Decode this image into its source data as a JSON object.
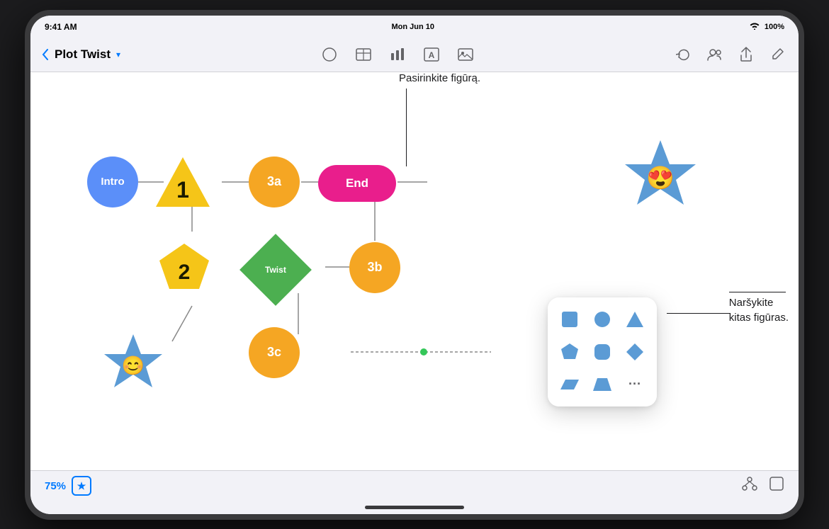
{
  "app": {
    "title": "Plot Twist",
    "status_time": "9:41 AM",
    "status_day": "Mon Jun 10",
    "battery": "100%",
    "zoom_level": "75%"
  },
  "annotations": {
    "top": "Pasirinkite figūrą.",
    "right_line1": "Naršykite",
    "right_line2": "kitas figūras."
  },
  "toolbar": {
    "back_label": "Plot Twist",
    "center_icons": [
      "circle-icon",
      "rectangle-icon",
      "layers-icon",
      "text-icon",
      "image-icon"
    ],
    "right_icons": [
      "rotate-icon",
      "person-icon",
      "share-icon",
      "pencil-icon"
    ]
  },
  "flowchart": {
    "nodes": [
      {
        "id": "intro",
        "label": "Intro",
        "shape": "circle",
        "color": "#5b8ff9"
      },
      {
        "id": "n1",
        "label": "1",
        "shape": "triangle",
        "color": "#f5c518"
      },
      {
        "id": "n3a",
        "label": "3a",
        "shape": "circle",
        "color": "#f5a623"
      },
      {
        "id": "end",
        "label": "End",
        "shape": "rounded-rect",
        "color": "#e91e8c"
      },
      {
        "id": "n2",
        "label": "2",
        "shape": "pentagon",
        "color": "#f5c518"
      },
      {
        "id": "twist",
        "label": "Twist",
        "shape": "diamond",
        "color": "#4caf50"
      },
      {
        "id": "n3b",
        "label": "3b",
        "shape": "circle",
        "color": "#f5a623"
      },
      {
        "id": "star-left",
        "label": "😊",
        "shape": "star",
        "color": "#5b9bd5"
      },
      {
        "id": "n3c",
        "label": "3c",
        "shape": "circle",
        "color": "#f5a623"
      },
      {
        "id": "star-right",
        "label": "😍",
        "shape": "star",
        "color": "#5b9bd5"
      }
    ]
  },
  "shape_picker": {
    "shapes": [
      {
        "name": "square",
        "color": "#5b9bd5"
      },
      {
        "name": "circle",
        "color": "#5b9bd5"
      },
      {
        "name": "triangle",
        "color": "#5b9bd5"
      },
      {
        "name": "pentagon",
        "color": "#5b9bd5"
      },
      {
        "name": "rounded-square",
        "color": "#5b9bd5"
      },
      {
        "name": "diamond",
        "color": "#5b9bd5"
      },
      {
        "name": "parallelogram",
        "color": "#5b9bd5"
      },
      {
        "name": "trapezoid",
        "color": "#5b9bd5"
      },
      {
        "name": "more",
        "color": "#636366",
        "label": "···"
      }
    ]
  },
  "bottom": {
    "zoom": "75%",
    "star_icon": "★"
  }
}
